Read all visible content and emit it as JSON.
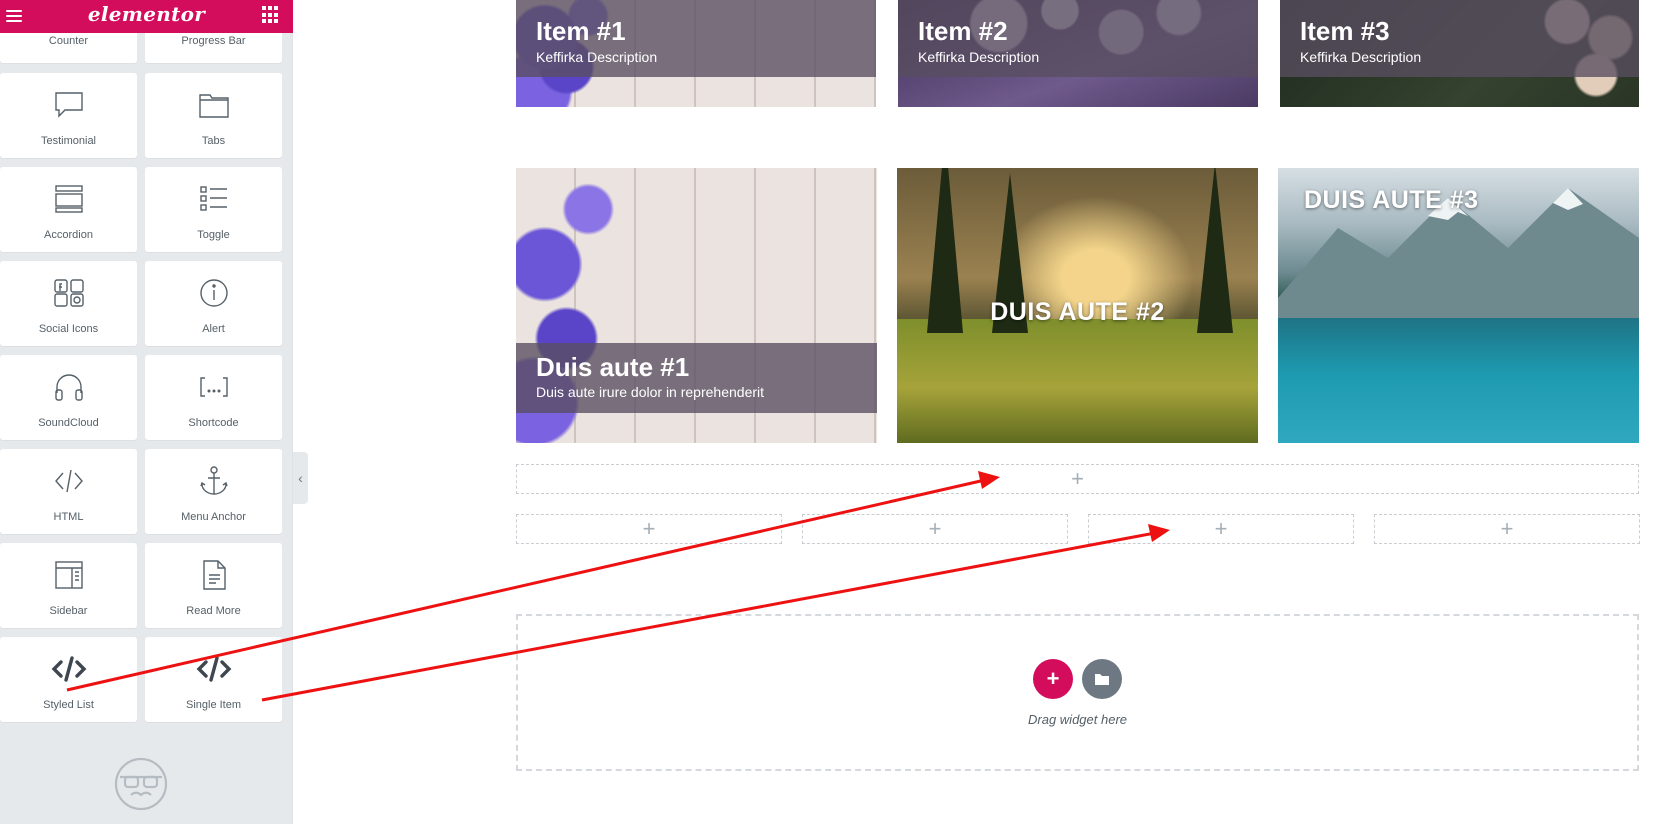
{
  "panel": {
    "logo": "elementor",
    "widgets_partial": [
      {
        "label": "Counter",
        "icon": "counter-icon"
      },
      {
        "label": "Progress Bar",
        "icon": "progress-bar-icon"
      }
    ],
    "widgets": [
      {
        "label": "Testimonial",
        "icon": "speech-bubble-icon"
      },
      {
        "label": "Tabs",
        "icon": "tabs-icon"
      },
      {
        "label": "Accordion",
        "icon": "accordion-icon"
      },
      {
        "label": "Toggle",
        "icon": "toggle-list-icon"
      },
      {
        "label": "Social Icons",
        "icon": "social-icons-icon"
      },
      {
        "label": "Alert",
        "icon": "info-icon"
      },
      {
        "label": "SoundCloud",
        "icon": "headphones-icon"
      },
      {
        "label": "Shortcode",
        "icon": "shortcode-brackets-icon"
      },
      {
        "label": "HTML",
        "icon": "code-icon"
      },
      {
        "label": "Menu Anchor",
        "icon": "anchor-icon"
      },
      {
        "label": "Sidebar",
        "icon": "sidebar-layout-icon"
      },
      {
        "label": "Read More",
        "icon": "document-icon"
      },
      {
        "label": "Styled List",
        "icon": "bold-code-icon"
      },
      {
        "label": "Single Item",
        "icon": "bold-code-icon"
      }
    ]
  },
  "canvas": {
    "top_items": [
      {
        "title": "Item #1",
        "description": "Keffirka Description"
      },
      {
        "title": "Item #2",
        "description": "Keffirka Description"
      },
      {
        "title": "Item #3",
        "description": "Keffirka Description"
      }
    ],
    "bottom_items": [
      {
        "title": "Duis aute #1",
        "description": "Duis aute irure dolor in reprehenderit"
      },
      {
        "title": "DUIS AUTE #2"
      },
      {
        "title": "DUIS AUTE #3"
      }
    ],
    "drop_plus": "+",
    "add_button": "+",
    "drag_hint": "Drag widget here"
  },
  "colors": {
    "brand": "#d30c5c",
    "panel_bg": "#e6e9ec",
    "arrow": "#ee1111",
    "secondary_button": "#6d7882"
  }
}
